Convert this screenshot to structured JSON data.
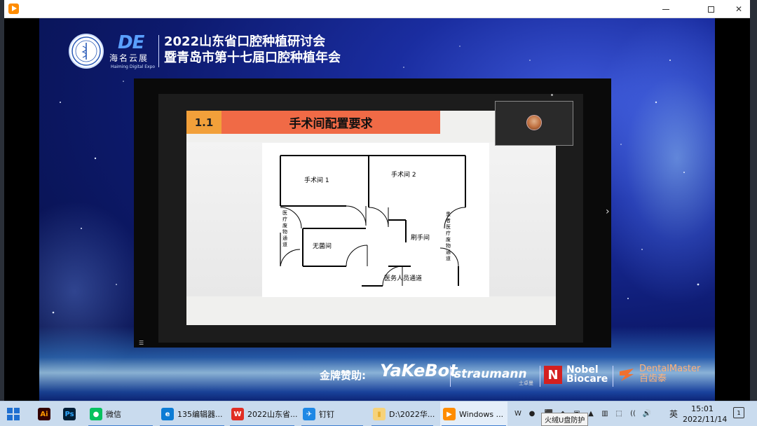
{
  "window": {
    "minimize_glyph": "—",
    "maximize_glyph": "☐",
    "close_glyph": "✕"
  },
  "event": {
    "brand_mark": "DE",
    "brand_cn": "海名云展",
    "brand_en": "Haiming Digital Expo",
    "title_line1": "2022山东省口腔种植研讨会",
    "title_line2": "暨青岛市第十七届口腔种植年会"
  },
  "slide": {
    "number": "1.1",
    "title": "手术间配置要求",
    "floorplan": {
      "room1": "手术间 1",
      "room2": "手术间 2",
      "sterile": "无菌间",
      "scrub": "刷手间",
      "staff_corridor": "医务人员通道",
      "left_corridor": "医疗废物通道",
      "right_corridor": "患者医疗废物通道"
    }
  },
  "share": {
    "next_arrow": "›",
    "menu_glyph": "☰"
  },
  "sponsors": {
    "label": "金牌赞助:",
    "yakebot": "YaKeBot",
    "straumann": "straumann",
    "straumann_sub": "士卓曼",
    "nobel_mark": "N",
    "nobel_line1": "Nobel",
    "nobel_line2": "Biocare",
    "dentalmaster_line1": "DentalMaster",
    "dentalmaster_line2": "百齿泰"
  },
  "taskbar": {
    "apps": [
      {
        "label": "",
        "icon": "Ai",
        "color": "#ff9a00",
        "bg": "#330000"
      },
      {
        "label": "",
        "icon": "Ps",
        "color": "#31a8ff",
        "bg": "#001e36"
      },
      {
        "label": "微信",
        "icon": "●",
        "color": "#ffffff",
        "bg": "#07c160"
      },
      {
        "label": "135编辑器...",
        "icon": "e",
        "color": "#ffffff",
        "bg": "#0c7cd5"
      },
      {
        "label": "2022山东省...",
        "icon": "W",
        "color": "#ffffff",
        "bg": "#e02e24"
      },
      {
        "label": "钉钉",
        "icon": "✈",
        "color": "#ffffff",
        "bg": "#1e88e5"
      },
      {
        "label": "D:\\2022华...",
        "icon": "▮",
        "color": "#e8b030",
        "bg": "#f6d27a"
      },
      {
        "label": "Windows ...",
        "icon": "▶",
        "color": "#ffffff",
        "bg": "#ff8c00"
      }
    ],
    "tray_icons": [
      "W",
      "●",
      "⬛",
      "◆",
      "▣",
      "▲",
      "▥",
      "⬚",
      "((",
      "🔊"
    ],
    "ime": "英",
    "time": "15:01",
    "date": "2022/11/14",
    "notification_badge": "1",
    "tooltip": "火绒U盘防护"
  },
  "colors": {
    "slide_number_bg": "#f2a03a",
    "slide_title_bg": "#f06a46",
    "video_bg": "#0d1a6e",
    "taskbar_bg": "#c9dbee"
  }
}
